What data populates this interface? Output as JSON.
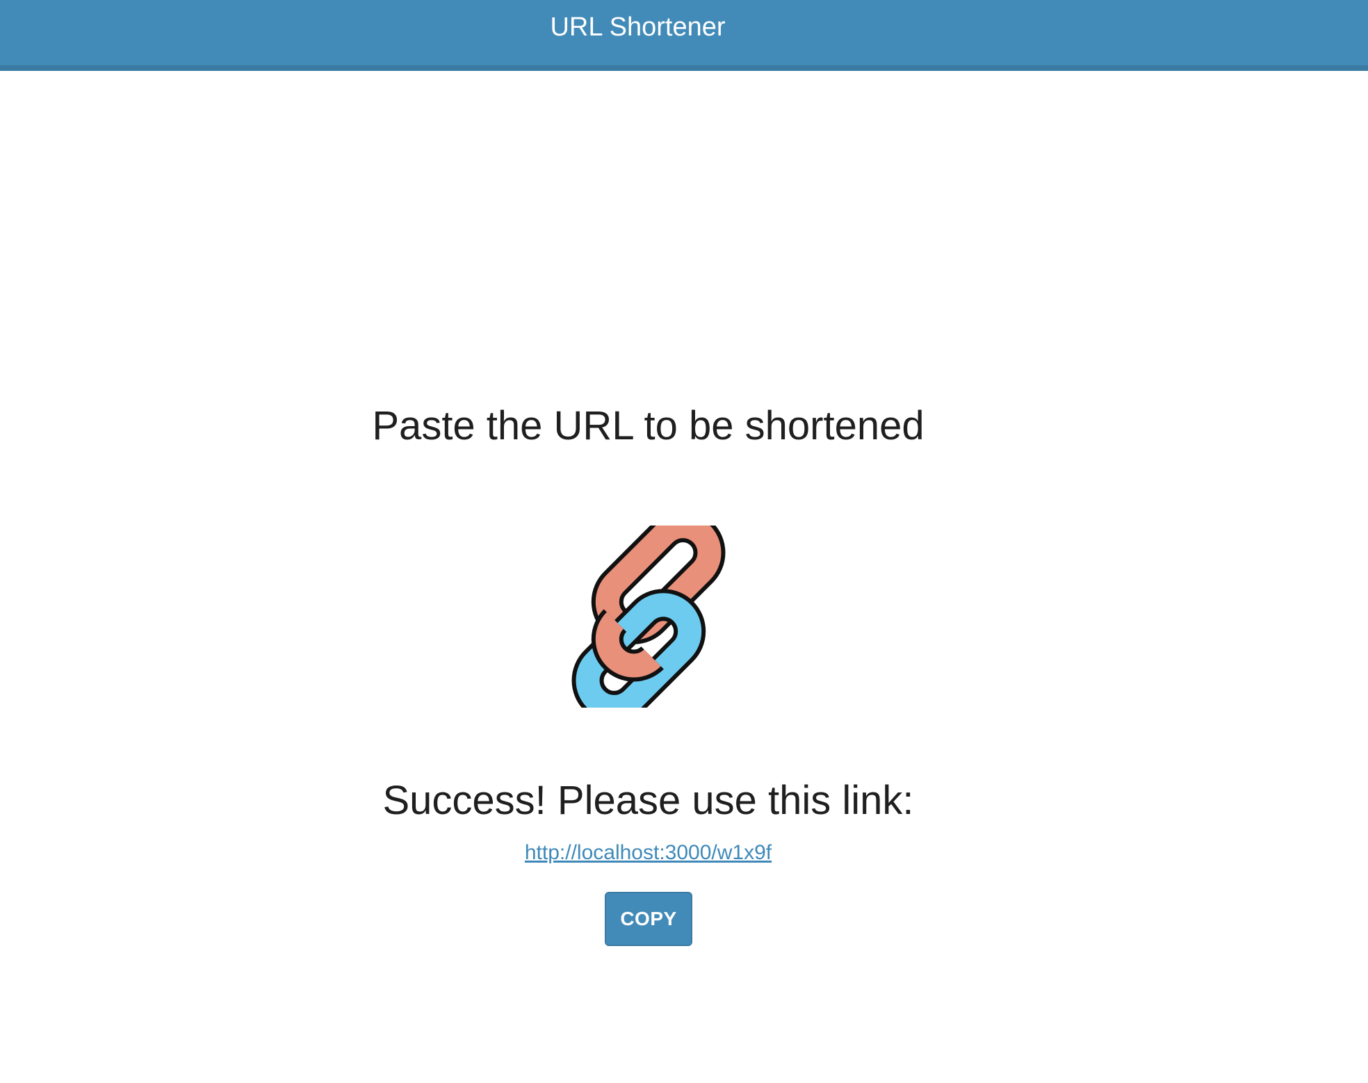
{
  "header": {
    "title": "URL Shortener"
  },
  "main": {
    "prompt": "Paste the URL to be shortened",
    "link_icon": "chain-link-icon",
    "success_message": "Success! Please use this link:",
    "short_url": "http://localhost:3000/w1x9f",
    "copy_label": "COPY"
  },
  "colors": {
    "header_bg": "#428bb8",
    "link_text": "#3f89b9",
    "chain_blue": "#6ecbf0",
    "chain_orange": "#e8907a",
    "button_bg": "#428bb8"
  }
}
